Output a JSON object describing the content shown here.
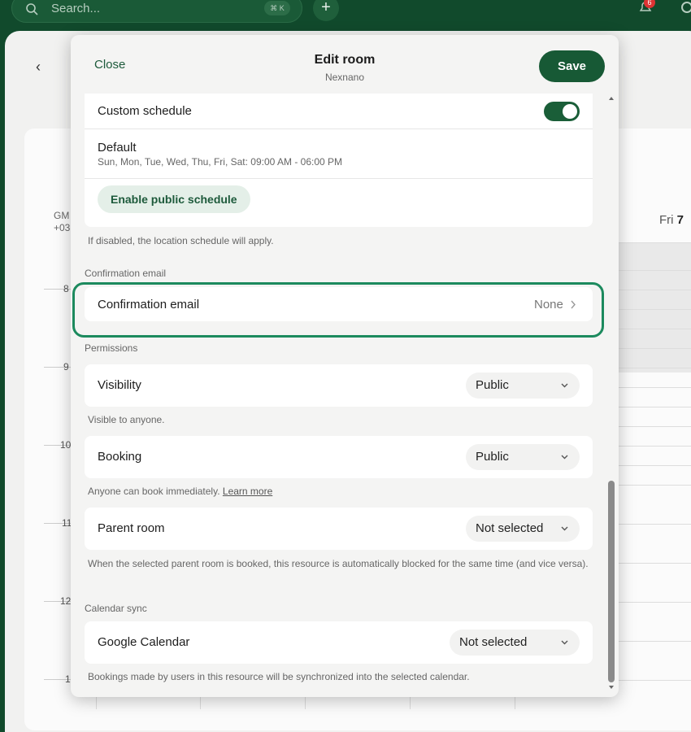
{
  "topbar": {
    "search_placeholder": "Search...",
    "search_shortcut": "⌘ K",
    "add_label": "+",
    "notification_count": "6"
  },
  "background": {
    "timezone_line1": "GM",
    "timezone_line2": "+03",
    "hours": [
      "8",
      "9",
      "10",
      "11",
      "12",
      "1"
    ],
    "day_name": "Fri",
    "day_number": "7"
  },
  "modal": {
    "close_label": "Close",
    "title": "Edit room",
    "subtitle": "Nexnano",
    "save_label": "Save"
  },
  "schedule": {
    "custom_schedule_label": "Custom schedule",
    "custom_schedule_on": true,
    "default_label": "Default",
    "default_hours": "Sun, Mon, Tue, Wed, Thu, Fri, Sat: 09:00 AM - 06:00 PM",
    "public_schedule_button": "Enable public schedule",
    "help": "If disabled, the location schedule will apply."
  },
  "confirmation": {
    "section_title": "Confirmation email",
    "label": "Confirmation email",
    "value": "None"
  },
  "permissions": {
    "section_title": "Permissions",
    "visibility_label": "Visibility",
    "visibility_value": "Public",
    "visibility_help": "Visible to anyone.",
    "booking_label": "Booking",
    "booking_value": "Public",
    "booking_help": "Anyone can book immediately.",
    "booking_help_link": "Learn more",
    "parent_label": "Parent room",
    "parent_value": "Not selected",
    "parent_help": "When the selected parent room is booked, this resource is automatically blocked for the same time (and vice versa)."
  },
  "calendar_sync": {
    "section_title": "Calendar sync",
    "google_label": "Google Calendar",
    "google_value": "Not selected",
    "google_help": "Bookings made by users in this resource will be synchronized into the selected calendar."
  },
  "colors": {
    "brand": "#175935",
    "highlight": "#1c8a5e"
  }
}
